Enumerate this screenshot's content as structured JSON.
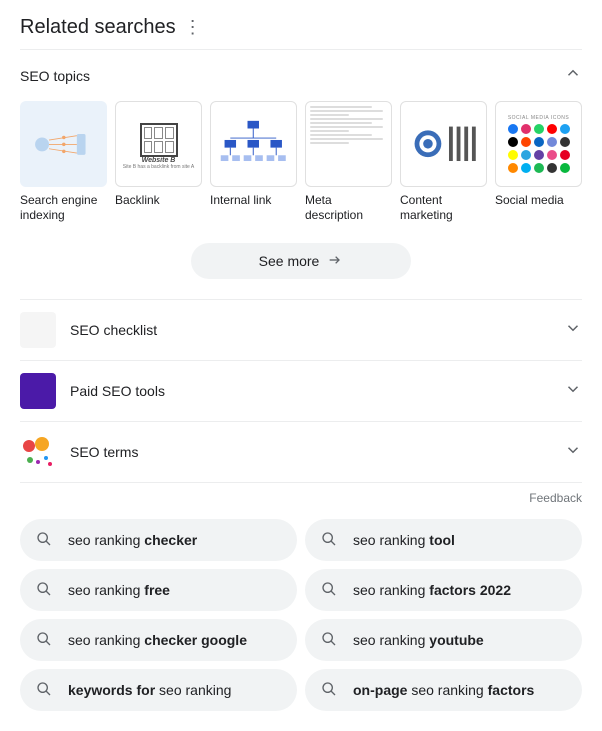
{
  "header": {
    "title": "Related searches"
  },
  "topics": {
    "title": "SEO topics",
    "cards": [
      {
        "label": "Search engine indexing"
      },
      {
        "label": "Backlink",
        "caption": "Website B",
        "sub": "Site B has a backlink from site A"
      },
      {
        "label": "Internal link"
      },
      {
        "label": "Meta description"
      },
      {
        "label": "Content marketing"
      },
      {
        "label": "Social media",
        "caption": "SOCIAL MEDIA ICONS"
      }
    ],
    "see_more": "See more"
  },
  "sections": [
    {
      "label": "SEO checklist"
    },
    {
      "label": "Paid SEO tools"
    },
    {
      "label": "SEO terms"
    }
  ],
  "feedback": "Feedback",
  "pills": [
    {
      "html": "seo ranking <b>checker</b>"
    },
    {
      "html": "seo ranking <b>tool</b>"
    },
    {
      "html": "seo ranking <b>free</b>"
    },
    {
      "html": "seo ranking <b>factors 2022</b>"
    },
    {
      "html": "seo ranking <b>checker google</b>"
    },
    {
      "html": "seo ranking <b>youtube</b>"
    },
    {
      "html": "<b>keywords for</b> seo ranking"
    },
    {
      "html": "<b>on-page</b> seo ranking <b>factors</b>"
    }
  ]
}
